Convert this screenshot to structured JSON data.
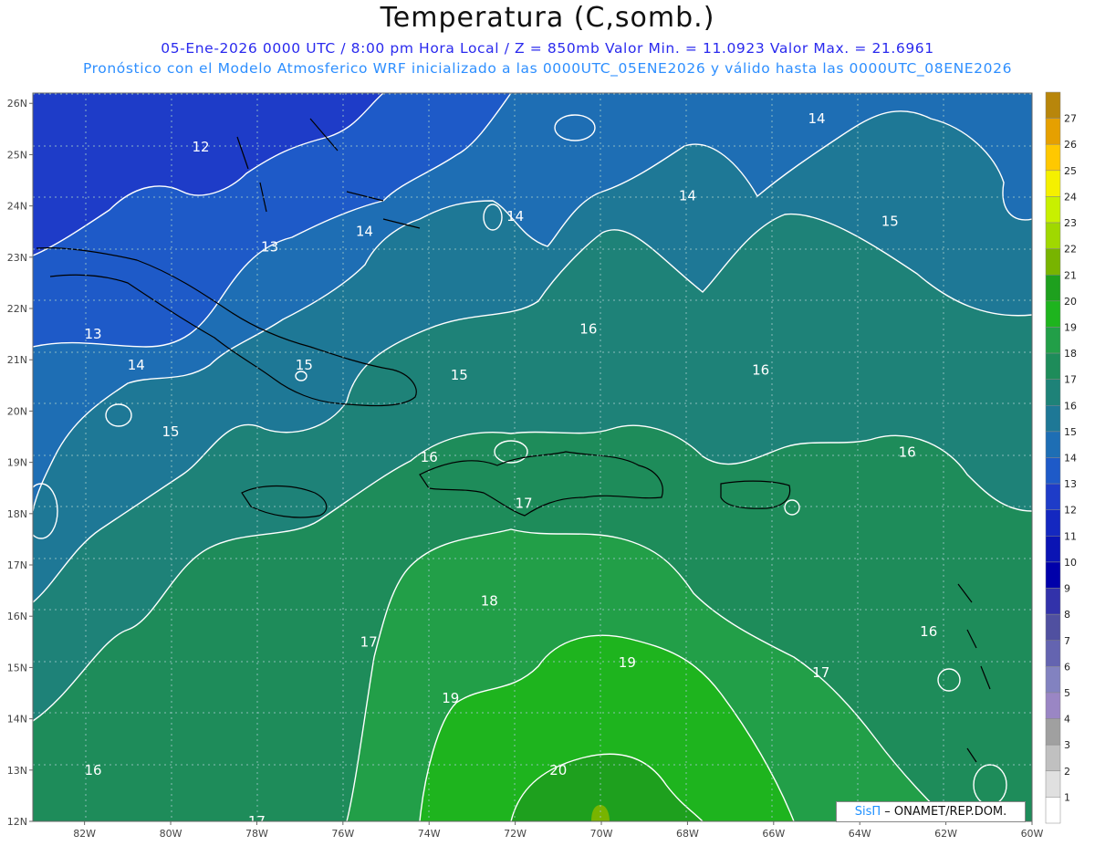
{
  "title": "Temperatura (C,somb.)",
  "subtitle_line1": "05-Ene-2026  0000 UTC / 8:00 pm Hora Local / Z = 850mb    Valor Min. = 11.0923  Valor Max. = 21.6961",
  "subtitle_line2": "Pronóstico con el Modelo Atmosferico WRF inicializado a las 0000UTC_05ENE2026 y válido hasta las  0000UTC_08ENE2026",
  "credit": {
    "brand": "SisΠ",
    "text": "– ONAMET/REP.DOM."
  },
  "axes": {
    "lon_labels": [
      "82W",
      "80W",
      "78W",
      "76W",
      "74W",
      "72W",
      "70W",
      "68W",
      "66W",
      "64W",
      "62W",
      "60W"
    ],
    "lat_labels": [
      "26N",
      "25N",
      "24N",
      "23N",
      "22N",
      "21N",
      "20N",
      "19N",
      "18N",
      "17N",
      "16N",
      "15N",
      "14N",
      "13N",
      "12N"
    ],
    "lon_range": [
      -83.2,
      -60
    ],
    "lat_range": [
      12,
      26.2
    ],
    "grid": true
  },
  "colorbar": {
    "levels": [
      {
        "value": "27",
        "color": "#b8860b"
      },
      {
        "value": "26",
        "color": "#e6a000"
      },
      {
        "value": "25",
        "color": "#ffc800"
      },
      {
        "value": "24",
        "color": "#f5f000"
      },
      {
        "value": "23",
        "color": "#c8f000"
      },
      {
        "value": "22",
        "color": "#a0d800"
      },
      {
        "value": "21",
        "color": "#78b400"
      },
      {
        "value": "20",
        "color": "#1ea01e"
      },
      {
        "value": "19",
        "color": "#1eb41e"
      },
      {
        "value": "18",
        "color": "#229f48"
      },
      {
        "value": "17",
        "color": "#1e8c5a"
      },
      {
        "value": "16",
        "color": "#1e8278"
      },
      {
        "value": "15",
        "color": "#1e7896"
      },
      {
        "value": "14",
        "color": "#1e6eb4"
      },
      {
        "value": "13",
        "color": "#1e5ac8"
      },
      {
        "value": "12",
        "color": "#1e3cc8"
      },
      {
        "value": "11",
        "color": "#1428c0"
      },
      {
        "value": "10",
        "color": "#0a14b4"
      },
      {
        "value": "9",
        "color": "#0000aa"
      },
      {
        "value": "8",
        "color": "#3232aa"
      },
      {
        "value": "7",
        "color": "#5050a0"
      },
      {
        "value": "6",
        "color": "#6464b0"
      },
      {
        "value": "5",
        "color": "#8282c0"
      },
      {
        "value": "4",
        "color": "#9a86c4"
      },
      {
        "value": "3",
        "color": "#a0a0a0"
      },
      {
        "value": "2",
        "color": "#c0c0c0"
      },
      {
        "value": "1",
        "color": "#e0e0e0"
      },
      {
        "value": "",
        "color": "#ffffff"
      }
    ]
  },
  "contour_labels": [
    {
      "text": "12",
      "lon": -79.3,
      "lat": 25.15
    },
    {
      "text": "13",
      "lon": -77.7,
      "lat": 23.2
    },
    {
      "text": "14",
      "lon": -75.5,
      "lat": 23.5
    },
    {
      "text": "14",
      "lon": -72.0,
      "lat": 23.8
    },
    {
      "text": "14",
      "lon": -65.0,
      "lat": 25.7
    },
    {
      "text": "14",
      "lon": -68.0,
      "lat": 24.2
    },
    {
      "text": "15",
      "lon": -63.3,
      "lat": 23.7
    },
    {
      "text": "13",
      "lon": -81.8,
      "lat": 21.5
    },
    {
      "text": "14",
      "lon": -80.8,
      "lat": 20.9
    },
    {
      "text": "15",
      "lon": -76.9,
      "lat": 20.9
    },
    {
      "text": "15",
      "lon": -73.3,
      "lat": 20.7
    },
    {
      "text": "15",
      "lon": -80.0,
      "lat": 19.6
    },
    {
      "text": "16",
      "lon": -70.3,
      "lat": 21.6
    },
    {
      "text": "16",
      "lon": -66.3,
      "lat": 20.8
    },
    {
      "text": "16",
      "lon": -74.0,
      "lat": 19.1
    },
    {
      "text": "16",
      "lon": -62.9,
      "lat": 19.2
    },
    {
      "text": "17",
      "lon": -71.8,
      "lat": 18.2
    },
    {
      "text": "18",
      "lon": -72.6,
      "lat": 16.3
    },
    {
      "text": "17",
      "lon": -75.4,
      "lat": 15.5
    },
    {
      "text": "19",
      "lon": -69.4,
      "lat": 15.1
    },
    {
      "text": "19",
      "lon": -73.5,
      "lat": 14.4
    },
    {
      "text": "17",
      "lon": -64.9,
      "lat": 14.9
    },
    {
      "text": "16",
      "lon": -62.4,
      "lat": 15.7
    },
    {
      "text": "16",
      "lon": -81.8,
      "lat": 13.0
    },
    {
      "text": "20",
      "lon": -71.0,
      "lat": 13.0
    },
    {
      "text": "17",
      "lon": -78.0,
      "lat": 12.0
    }
  ]
}
